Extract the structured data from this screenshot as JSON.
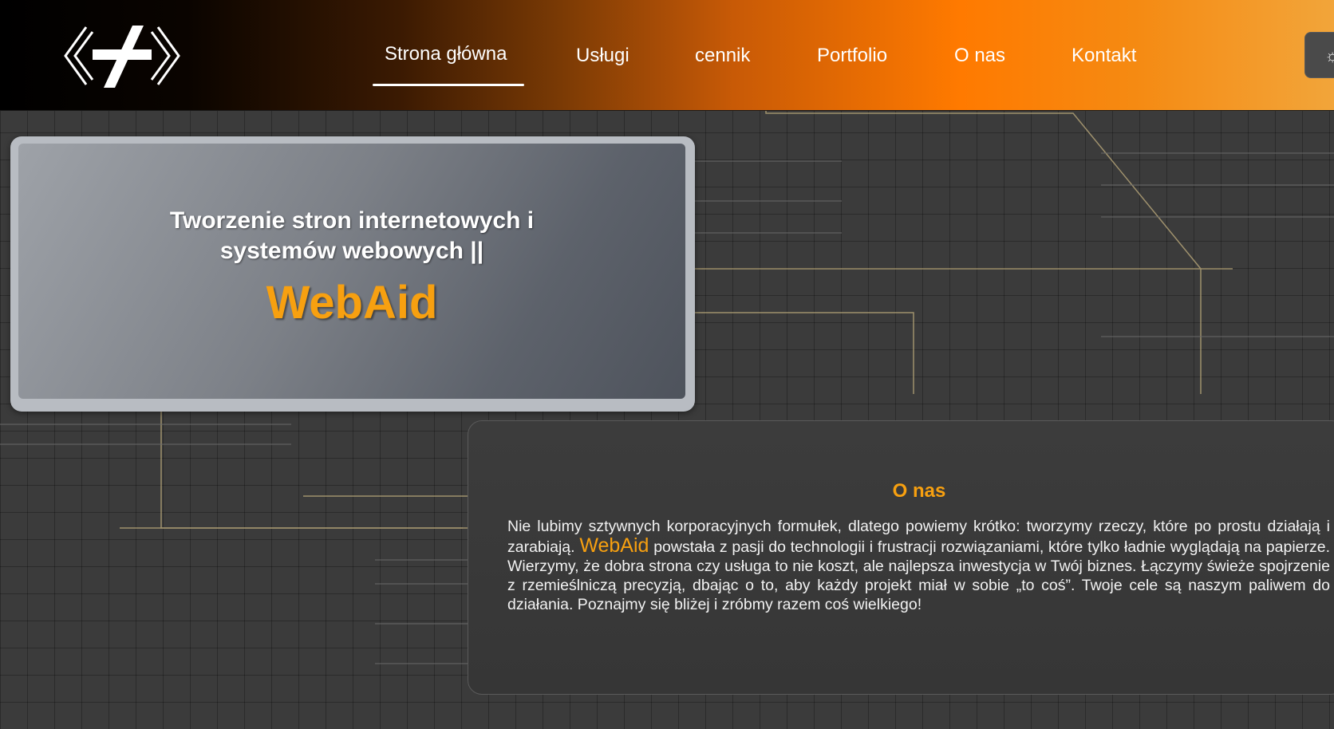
{
  "nav": {
    "items": [
      {
        "label": "Strona główna",
        "active": true
      },
      {
        "label": "Usługi"
      },
      {
        "label": "cennik"
      },
      {
        "label": "Portfolio"
      },
      {
        "label": "O nas"
      },
      {
        "label": "Kontakt"
      }
    ],
    "theme_toggle_icon": "sun-icon",
    "theme_toggle_glyph": "☼"
  },
  "hero": {
    "title_line1": "Tworzenie stron internetowych i",
    "title_line2": "systemów webowych ||",
    "brand": "WebAid"
  },
  "about": {
    "title": "O nas",
    "text_before": "Nie lubimy sztywnych korporacyjnych formułek, dlatego powiemy krótko: tworzymy rzeczy, które po prostu działają i zarabiają. ",
    "brand": "WebAid",
    "text_after": " powstała z pasji do technologii i frustracji rozwiązaniami, które tylko ładnie wyglądają na papierze. Wierzymy, że dobra strona czy usługa to nie koszt, ale najlepsza inwestycja w Twój biznes. Łączymy świeże spojrzenie z rzemieślniczą precyzją, dbając o to, aby każdy projekt miał w sobie „to coś”. Twoje cele są naszym paliwem do działania. Poznajmy się bliżej i zróbmy razem coś wielkiego!"
  },
  "colors": {
    "accent": "#f7a010",
    "header_orange": "#ff7a00"
  }
}
